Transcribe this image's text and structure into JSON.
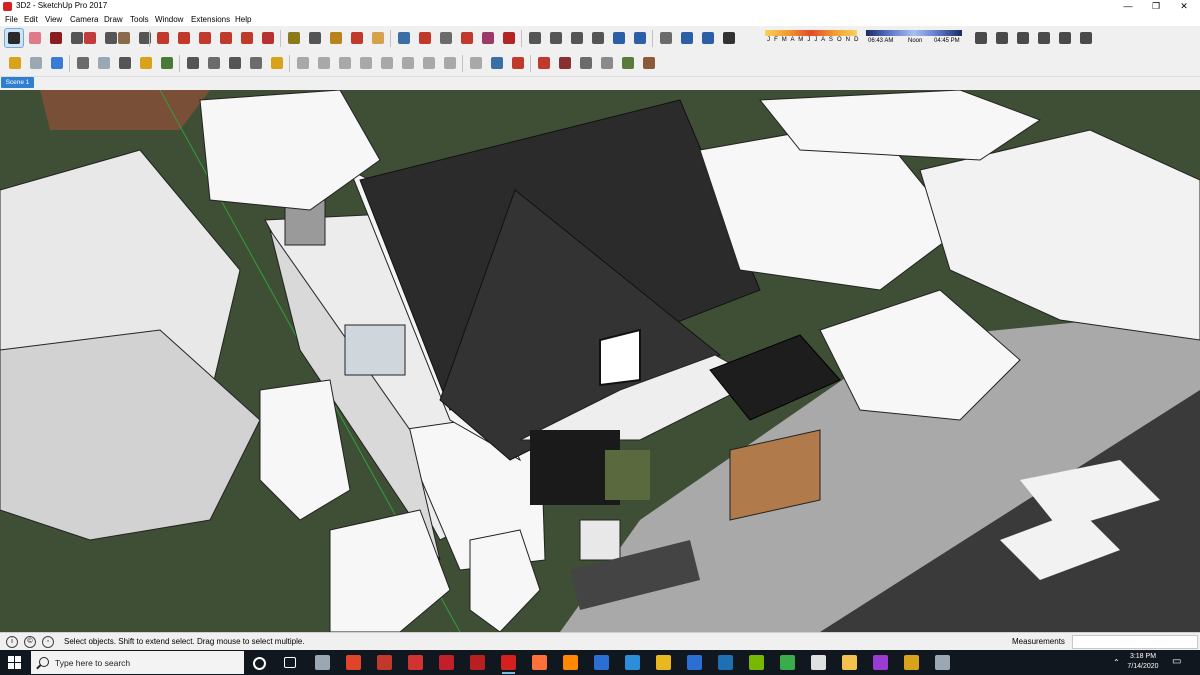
{
  "window": {
    "title": "3D2 - SketchUp Pro 2017",
    "controls": {
      "minimize": "—",
      "restore": "❐",
      "close": "✕"
    }
  },
  "menu": [
    "File",
    "Edit",
    "View",
    "Camera",
    "Draw",
    "Tools",
    "Window",
    "Extensions",
    "Help"
  ],
  "toolbar1": {
    "tools": [
      {
        "name": "select-tool",
        "color": "#2a2a2a",
        "active": true
      },
      {
        "name": "eraser-tool",
        "color": "#e07a8a"
      },
      {
        "name": "line-tool",
        "color": "#8a1c1c"
      },
      {
        "name": "line-dropdown",
        "color": "#555555"
      },
      {
        "name": "arc-tool",
        "color": "#c23c3c"
      },
      {
        "name": "arc-dropdown",
        "color": "#555555"
      },
      {
        "name": "rectangle-tool",
        "color": "#8a6b4a"
      },
      {
        "name": "shape-dropdown",
        "color": "#555555"
      },
      {
        "name": "push-pull-tool",
        "color": "#c0392b"
      },
      {
        "name": "follow-me-tool",
        "color": "#c0392b"
      },
      {
        "name": "move-tool",
        "color": "#c0392b"
      },
      {
        "name": "rotate-tool",
        "color": "#c0392b"
      },
      {
        "name": "scale-tool",
        "color": "#c0392b"
      },
      {
        "name": "offset-tool",
        "color": "#b83232"
      },
      {
        "name": "tape-measure-tool",
        "color": "#8a7a1a"
      },
      {
        "name": "text-tool",
        "color": "#555555"
      },
      {
        "name": "paint-bucket-tool",
        "color": "#b8821c"
      },
      {
        "name": "orbit-tool",
        "color": "#c0392b"
      },
      {
        "name": "pan-tool",
        "color": "#d4a24a"
      },
      {
        "name": "zoom-tool",
        "color": "#3a6ea5"
      },
      {
        "name": "zoom-extents-tool",
        "color": "#c0392b"
      },
      {
        "name": "previous-view",
        "color": "#6b6b6b"
      },
      {
        "name": "warehouse-tool",
        "color": "#c0392b"
      },
      {
        "name": "components-tool",
        "color": "#9b3a6a"
      },
      {
        "name": "extension-tool",
        "color": "#b32424"
      },
      {
        "name": "view-iso",
        "color": "#555555"
      },
      {
        "name": "view-top",
        "color": "#555555"
      },
      {
        "name": "view-front",
        "color": "#555555"
      },
      {
        "name": "view-right",
        "color": "#555555"
      },
      {
        "name": "view-back",
        "color": "#2d5fa8"
      },
      {
        "name": "view-left",
        "color": "#2d5fa8"
      },
      {
        "name": "axes-tool",
        "color": "#6b6b6b"
      },
      {
        "name": "section-tool",
        "color": "#2d5fa8"
      },
      {
        "name": "section-display",
        "color": "#2d5fa8"
      },
      {
        "name": "shadow-toggle",
        "color": "#333333"
      }
    ],
    "shadow_months": "J F M A M J J A S O N D",
    "time_start": "06:43 AM",
    "time_mid": "Noon",
    "time_end": "04:45 PM",
    "style_tools": [
      {
        "name": "xray-style",
        "color": "#555555"
      },
      {
        "name": "back-edges-style",
        "color": "#555555"
      },
      {
        "name": "wireframe-style",
        "color": "#2a2a2a"
      },
      {
        "name": "hidden-line-style",
        "color": "#2a2a2a"
      },
      {
        "name": "shaded-style",
        "color": "#2a2a2a"
      },
      {
        "name": "textured-style",
        "color": "#2a2a2a"
      }
    ]
  },
  "toolbar2": {
    "tools": [
      {
        "name": "solid-tools",
        "color": "#d9a21b"
      },
      {
        "name": "outer-shell-tool",
        "color": "#9aa7b5"
      },
      {
        "name": "sandbox-tool",
        "color": "#3a7bd5"
      },
      {
        "name": "stamp-tool",
        "color": "#6b6b6b"
      },
      {
        "name": "add-location",
        "color": "#9aa7b5"
      },
      {
        "name": "toggle-terrain",
        "color": "#555555"
      },
      {
        "name": "add-detail",
        "color": "#d9a21b"
      },
      {
        "name": "share-model",
        "color": "#4a7a3a"
      },
      {
        "name": "photo-textures",
        "color": "#555555"
      },
      {
        "name": "sound-tool",
        "color": "#6b6b6b"
      },
      {
        "name": "layers-tool",
        "color": "#555555"
      },
      {
        "name": "dialog-tool",
        "color": "#6b6b6b"
      },
      {
        "name": "walk-tool",
        "color": "#d9a21b"
      },
      {
        "name": "dimension-tool",
        "color": "#a8a8a8"
      },
      {
        "name": "protractor-tool",
        "color": "#a8a8a8"
      },
      {
        "name": "label-tool",
        "color": "#a8a8a8"
      },
      {
        "name": "3d-text-tool",
        "color": "#a8a8a8"
      },
      {
        "name": "section-plane-tool",
        "color": "#a8a8a8"
      },
      {
        "name": "position-camera-tool",
        "color": "#a8a8a8"
      },
      {
        "name": "look-around-tool",
        "color": "#a8a8a8"
      },
      {
        "name": "walk-through-tool",
        "color": "#a8a8a8"
      },
      {
        "name": "axis-tool-2",
        "color": "#a8a8a8"
      },
      {
        "name": "geo-location-tool",
        "color": "#3a6ea5"
      },
      {
        "name": "sandbox-from-contours",
        "color": "#c0392b"
      },
      {
        "name": "sandbox-from-scratch",
        "color": "#c0392b"
      },
      {
        "name": "smoove-tool",
        "color": "#8a3030"
      },
      {
        "name": "stamp-tool-2",
        "color": "#6b6b6b"
      },
      {
        "name": "drape-tool",
        "color": "#8a8a8a"
      },
      {
        "name": "add-detail-2",
        "color": "#5a7a3a"
      },
      {
        "name": "flip-edge-tool",
        "color": "#8a5a3a"
      }
    ]
  },
  "view_tools_right": [
    {
      "name": "house-front",
      "color": "#4a4a4a"
    },
    {
      "name": "house-side",
      "color": "#4a4a4a"
    },
    {
      "name": "house-top",
      "color": "#4a4a4a"
    },
    {
      "name": "house-back",
      "color": "#4a4a4a"
    },
    {
      "name": "house-outline",
      "color": "#4a4a4a"
    },
    {
      "name": "house-plan",
      "color": "#4a4a4a"
    }
  ],
  "scene_tab": "Scene 1",
  "viewport": {
    "colors": {
      "grass": "#3f4f35",
      "road": "#3a3a3a",
      "sidewalk": "#a9a9a9",
      "roof": "#2b2b2b",
      "wall": "#f2f2f2",
      "tree": "#f7f7f7"
    }
  },
  "status": {
    "message": "Select objects. Shift to extend select. Drag mouse to select multiple.",
    "measurements_label": "Measurements",
    "measurements_value": ""
  },
  "taskbar": {
    "search_placeholder": "Type here to search",
    "apps": [
      {
        "name": "cortana",
        "color": "#ffffff"
      },
      {
        "name": "task-view",
        "color": "#ffffff"
      },
      {
        "name": "camera-app",
        "color": "#9aa7b5"
      },
      {
        "name": "app-red-c",
        "color": "#e0442a"
      },
      {
        "name": "media-player",
        "color": "#c0392b"
      },
      {
        "name": "pdf-reader",
        "color": "#d13232"
      },
      {
        "name": "autocad",
        "color": "#c0202a"
      },
      {
        "name": "app-red",
        "color": "#b82020"
      },
      {
        "name": "sketchup",
        "color": "#d4201e",
        "running": true
      },
      {
        "name": "firefox",
        "color": "#ff7139"
      },
      {
        "name": "vlc",
        "color": "#ff8800"
      },
      {
        "name": "malwarebytes",
        "color": "#2a6fd1"
      },
      {
        "name": "edge",
        "color": "#2a8fd8"
      },
      {
        "name": "chrome",
        "color": "#e8b81f"
      },
      {
        "name": "mail",
        "color": "#2a6fd1"
      },
      {
        "name": "photoshop",
        "color": "#1f6fb5"
      },
      {
        "name": "nvidia",
        "color": "#76b900"
      },
      {
        "name": "camtasia",
        "color": "#3aad4a"
      },
      {
        "name": "store",
        "color": "#e0e0e0"
      },
      {
        "name": "file-explorer",
        "color": "#f2c14e"
      },
      {
        "name": "premiere",
        "color": "#9a3bd1"
      },
      {
        "name": "media-app",
        "color": "#d9a21b"
      },
      {
        "name": "tool-app",
        "color": "#9aa7b5"
      }
    ],
    "time": "3:18 PM",
    "date": "7/14/2020"
  }
}
